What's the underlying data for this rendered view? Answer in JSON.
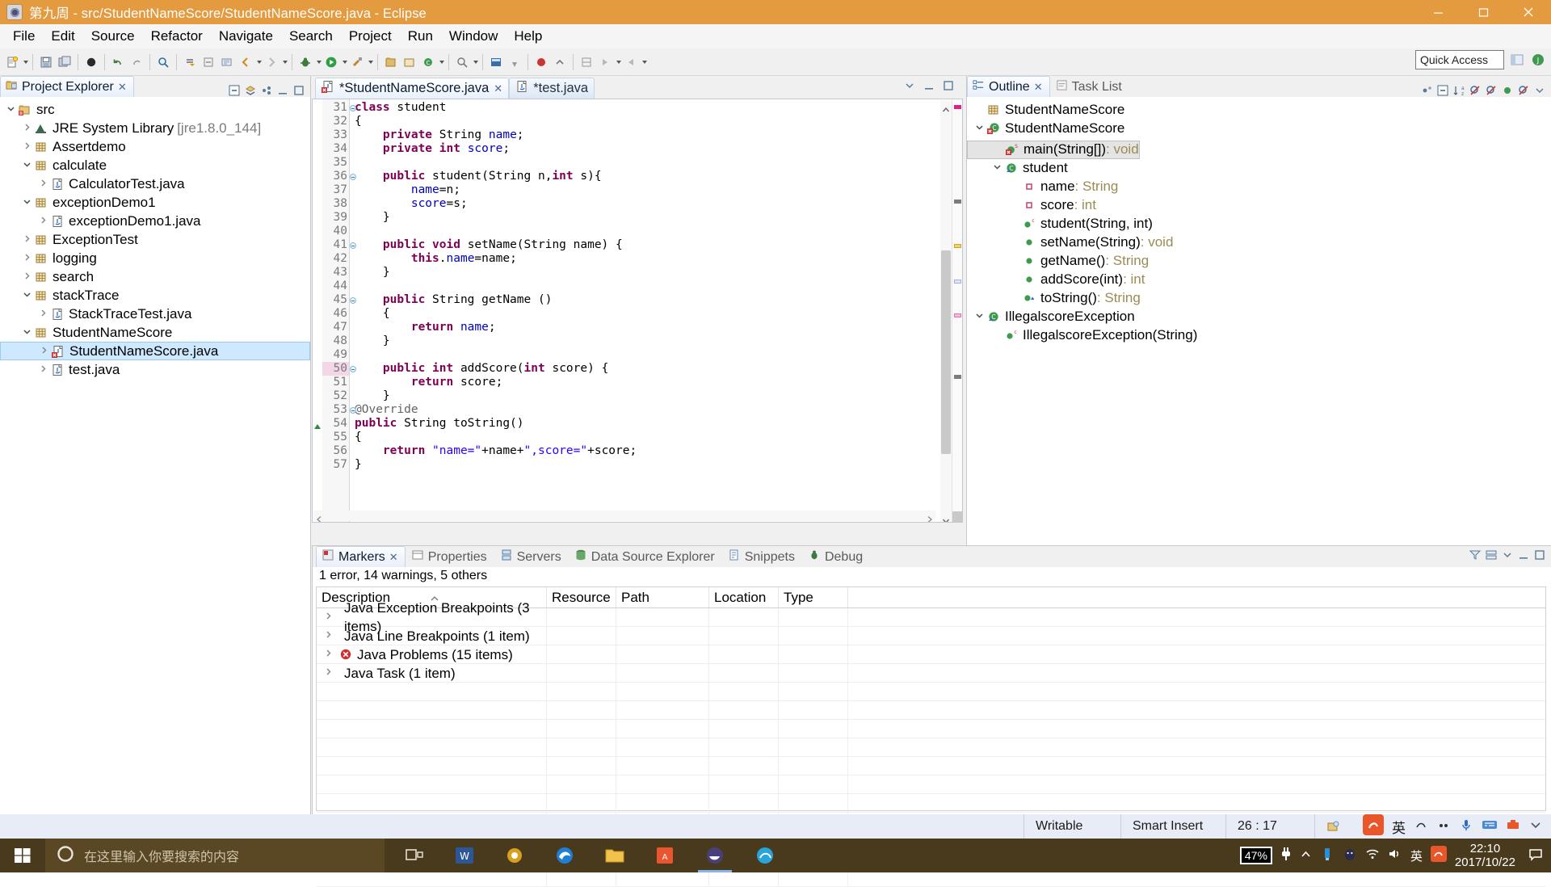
{
  "window": {
    "title": "第九周 - src/StudentNameScore/StudentNameScore.java - Eclipse",
    "minimize_label": "Minimize",
    "maximize_label": "Maximize",
    "close_label": "Close"
  },
  "menubar": {
    "items": [
      "File",
      "Edit",
      "Source",
      "Refactor",
      "Navigate",
      "Search",
      "Project",
      "Run",
      "Window",
      "Help"
    ]
  },
  "toolbar": {
    "quick_access_placeholder": "Quick Access"
  },
  "explorer": {
    "tab_label": "Project Explorer",
    "tree": [
      {
        "depth": 0,
        "twist": "v",
        "icon": "source-folder-icon",
        "label": "src",
        "dim": "",
        "selected": false
      },
      {
        "depth": 1,
        "twist": ">",
        "icon": "library-icon",
        "label": "JRE System Library",
        "dim": "[jre1.8.0_144]",
        "selected": false
      },
      {
        "depth": 1,
        "twist": ">",
        "icon": "package-icon",
        "label": "Assertdemo",
        "dim": "",
        "selected": false
      },
      {
        "depth": 1,
        "twist": "v",
        "icon": "package-icon",
        "label": "calculate",
        "dim": "",
        "selected": false
      },
      {
        "depth": 2,
        "twist": ">",
        "icon": "java-file-icon",
        "label": "CalculatorTest.java",
        "dim": "",
        "selected": false
      },
      {
        "depth": 1,
        "twist": "v",
        "icon": "package-icon",
        "label": "exceptionDemo1",
        "dim": "",
        "selected": false
      },
      {
        "depth": 2,
        "twist": ">",
        "icon": "java-file-icon",
        "label": "exceptionDemo1.java",
        "dim": "",
        "selected": false
      },
      {
        "depth": 1,
        "twist": ">",
        "icon": "package-icon",
        "label": "ExceptionTest",
        "dim": "",
        "selected": false
      },
      {
        "depth": 1,
        "twist": ">",
        "icon": "package-icon",
        "label": "logging",
        "dim": "",
        "selected": false
      },
      {
        "depth": 1,
        "twist": ">",
        "icon": "package-icon",
        "label": "search",
        "dim": "",
        "selected": false
      },
      {
        "depth": 1,
        "twist": "v",
        "icon": "package-icon",
        "label": "stackTrace",
        "dim": "",
        "selected": false
      },
      {
        "depth": 2,
        "twist": ">",
        "icon": "java-file-icon",
        "label": "StackTraceTest.java",
        "dim": "",
        "selected": false
      },
      {
        "depth": 1,
        "twist": "v",
        "icon": "package-icon",
        "label": "StudentNameScore",
        "dim": "",
        "selected": false
      },
      {
        "depth": 2,
        "twist": ">",
        "icon": "java-file-error-icon",
        "label": "StudentNameScore.java",
        "dim": "",
        "selected": true
      },
      {
        "depth": 2,
        "twist": ">",
        "icon": "java-file-icon",
        "label": "test.java",
        "dim": "",
        "selected": false
      }
    ]
  },
  "editor": {
    "tabs": [
      {
        "label": "*StudentNameScore.java",
        "active": true,
        "icon": "java-file-error-icon",
        "closable": true
      },
      {
        "label": "*test.java",
        "active": false,
        "icon": "java-file-icon",
        "closable": false
      }
    ],
    "first_line": 31,
    "current_line": 50,
    "lines": [
      {
        "n": 31,
        "fold": true,
        "marker": "",
        "tokens": [
          {
            "t": "class ",
            "c": "kw"
          },
          {
            "t": "student",
            "c": ""
          }
        ]
      },
      {
        "n": 32,
        "fold": false,
        "marker": "",
        "tokens": [
          {
            "t": "{",
            "c": ""
          }
        ]
      },
      {
        "n": 33,
        "fold": false,
        "marker": "",
        "tokens": [
          {
            "t": "    ",
            "c": ""
          },
          {
            "t": "private ",
            "c": "kw"
          },
          {
            "t": "String ",
            "c": ""
          },
          {
            "t": "name",
            "c": "fld"
          },
          {
            "t": ";",
            "c": ""
          }
        ]
      },
      {
        "n": 34,
        "fold": false,
        "marker": "",
        "tokens": [
          {
            "t": "    ",
            "c": ""
          },
          {
            "t": "private int ",
            "c": "kw"
          },
          {
            "t": "score",
            "c": "fld"
          },
          {
            "t": ";",
            "c": ""
          }
        ]
      },
      {
        "n": 35,
        "fold": false,
        "marker": "",
        "tokens": [
          {
            "t": "",
            "c": ""
          }
        ]
      },
      {
        "n": 36,
        "fold": true,
        "marker": "",
        "tokens": [
          {
            "t": "    ",
            "c": ""
          },
          {
            "t": "public ",
            "c": "kw"
          },
          {
            "t": "student(String n,",
            "c": ""
          },
          {
            "t": "int",
            "c": "kw"
          },
          {
            "t": " s){",
            "c": ""
          }
        ]
      },
      {
        "n": 37,
        "fold": false,
        "marker": "",
        "tokens": [
          {
            "t": "        ",
            "c": ""
          },
          {
            "t": "name",
            "c": "fld"
          },
          {
            "t": "=n;",
            "c": ""
          }
        ]
      },
      {
        "n": 38,
        "fold": false,
        "marker": "",
        "tokens": [
          {
            "t": "        ",
            "c": ""
          },
          {
            "t": "score",
            "c": "fld"
          },
          {
            "t": "=s;",
            "c": ""
          }
        ]
      },
      {
        "n": 39,
        "fold": false,
        "marker": "",
        "tokens": [
          {
            "t": "    }",
            "c": ""
          }
        ]
      },
      {
        "n": 40,
        "fold": false,
        "marker": "",
        "tokens": [
          {
            "t": "",
            "c": ""
          }
        ]
      },
      {
        "n": 41,
        "fold": true,
        "marker": "",
        "tokens": [
          {
            "t": "    ",
            "c": ""
          },
          {
            "t": "public void ",
            "c": "kw"
          },
          {
            "t": "setName(String name) {",
            "c": ""
          }
        ]
      },
      {
        "n": 42,
        "fold": false,
        "marker": "",
        "tokens": [
          {
            "t": "        ",
            "c": ""
          },
          {
            "t": "this",
            "c": "kw"
          },
          {
            "t": ".",
            "c": ""
          },
          {
            "t": "name",
            "c": "fld"
          },
          {
            "t": "=name;",
            "c": ""
          }
        ]
      },
      {
        "n": 43,
        "fold": false,
        "marker": "",
        "tokens": [
          {
            "t": "    }",
            "c": ""
          }
        ]
      },
      {
        "n": 44,
        "fold": false,
        "marker": "",
        "tokens": [
          {
            "t": "",
            "c": ""
          }
        ]
      },
      {
        "n": 45,
        "fold": true,
        "marker": "",
        "tokens": [
          {
            "t": "    ",
            "c": ""
          },
          {
            "t": "public ",
            "c": "kw"
          },
          {
            "t": "String getName ()",
            "c": ""
          }
        ]
      },
      {
        "n": 46,
        "fold": false,
        "marker": "",
        "tokens": [
          {
            "t": "    {",
            "c": ""
          }
        ]
      },
      {
        "n": 47,
        "fold": false,
        "marker": "",
        "tokens": [
          {
            "t": "        ",
            "c": ""
          },
          {
            "t": "return ",
            "c": "kw"
          },
          {
            "t": "name",
            "c": "fld"
          },
          {
            "t": ";",
            "c": ""
          }
        ]
      },
      {
        "n": 48,
        "fold": false,
        "marker": "",
        "tokens": [
          {
            "t": "    }",
            "c": ""
          }
        ]
      },
      {
        "n": 49,
        "fold": false,
        "marker": "",
        "tokens": [
          {
            "t": "",
            "c": ""
          }
        ]
      },
      {
        "n": 50,
        "fold": true,
        "marker": "",
        "tokens": [
          {
            "t": "    ",
            "c": ""
          },
          {
            "t": "public int ",
            "c": "kw"
          },
          {
            "t": "addScore(",
            "c": ""
          },
          {
            "t": "int",
            "c": "kw"
          },
          {
            "t": " score) {",
            "c": ""
          }
        ]
      },
      {
        "n": 51,
        "fold": false,
        "marker": "",
        "tokens": [
          {
            "t": "        ",
            "c": ""
          },
          {
            "t": "return ",
            "c": "kw"
          },
          {
            "t": "score;",
            "c": ""
          }
        ]
      },
      {
        "n": 52,
        "fold": false,
        "marker": "",
        "tokens": [
          {
            "t": "    }",
            "c": ""
          }
        ]
      },
      {
        "n": 53,
        "fold": true,
        "marker": "",
        "tokens": [
          {
            "t": "@Override",
            "c": "ann"
          }
        ]
      },
      {
        "n": 54,
        "fold": false,
        "marker": "override",
        "tokens": [
          {
            "t": "public ",
            "c": "kw"
          },
          {
            "t": "String toString()",
            "c": ""
          }
        ]
      },
      {
        "n": 55,
        "fold": false,
        "marker": "",
        "tokens": [
          {
            "t": "{",
            "c": ""
          }
        ]
      },
      {
        "n": 56,
        "fold": false,
        "marker": "",
        "tokens": [
          {
            "t": "    ",
            "c": ""
          },
          {
            "t": "return ",
            "c": "kw"
          },
          {
            "t": "\"name=\"",
            "c": "str"
          },
          {
            "t": "+name+",
            "c": ""
          },
          {
            "t": "\",score=\"",
            "c": "str"
          },
          {
            "t": "+score;",
            "c": ""
          }
        ]
      },
      {
        "n": 57,
        "fold": false,
        "marker": "",
        "tokens": [
          {
            "t": "}",
            "c": ""
          }
        ]
      }
    ]
  },
  "outline": {
    "tabs": [
      {
        "label": "Outline",
        "active": true,
        "icon": "outline-icon"
      },
      {
        "label": "Task List",
        "active": false,
        "icon": "tasklist-icon"
      }
    ],
    "items": [
      {
        "depth": 0,
        "twist": "",
        "icon": "package-icon",
        "label": "StudentNameScore",
        "type": "",
        "selected": false
      },
      {
        "depth": 0,
        "twist": "v",
        "icon": "class-error-icon",
        "label": "StudentNameScore",
        "type": "",
        "selected": false
      },
      {
        "depth": 1,
        "twist": "",
        "icon": "method-static-error-icon",
        "label": "main(String[])",
        "type": " : void",
        "selected": true
      },
      {
        "depth": 1,
        "twist": "v",
        "icon": "class-icon",
        "label": "student",
        "type": "",
        "selected": false
      },
      {
        "depth": 2,
        "twist": "",
        "icon": "field-private-icon",
        "label": "name",
        "type": " : String",
        "selected": false
      },
      {
        "depth": 2,
        "twist": "",
        "icon": "field-private-icon",
        "label": "score",
        "type": " : int",
        "selected": false
      },
      {
        "depth": 2,
        "twist": "",
        "icon": "constructor-icon",
        "label": "student(String, int)",
        "type": "",
        "selected": false
      },
      {
        "depth": 2,
        "twist": "",
        "icon": "method-icon",
        "label": "setName(String)",
        "type": " : void",
        "selected": false
      },
      {
        "depth": 2,
        "twist": "",
        "icon": "method-icon",
        "label": "getName()",
        "type": " : String",
        "selected": false
      },
      {
        "depth": 2,
        "twist": "",
        "icon": "method-icon",
        "label": "addScore(int)",
        "type": " : int",
        "selected": false
      },
      {
        "depth": 2,
        "twist": "",
        "icon": "method-override-icon",
        "label": "toString()",
        "type": " : String",
        "selected": false
      },
      {
        "depth": 0,
        "twist": "v",
        "icon": "class-icon",
        "label": "IllegalscoreException",
        "type": "",
        "selected": false
      },
      {
        "depth": 1,
        "twist": "",
        "icon": "constructor-icon",
        "label": "IllegalscoreException(String)",
        "type": "",
        "selected": false
      }
    ]
  },
  "markers": {
    "tabs": [
      {
        "label": "Markers",
        "active": true,
        "icon": "markers-icon"
      },
      {
        "label": "Properties",
        "active": false,
        "icon": "properties-icon"
      },
      {
        "label": "Servers",
        "active": false,
        "icon": "servers-icon"
      },
      {
        "label": "Data Source Explorer",
        "active": false,
        "icon": "datasource-icon"
      },
      {
        "label": "Snippets",
        "active": false,
        "icon": "snippets-icon"
      },
      {
        "label": "Debug",
        "active": false,
        "icon": "debug-icon"
      }
    ],
    "summary": "1 error, 14 warnings, 5 others",
    "columns": [
      "Description",
      "Resource",
      "Path",
      "Location",
      "Type"
    ],
    "rows": [
      {
        "icon": "",
        "description": "Java Exception Breakpoints (3 items)",
        "resource": "",
        "path": "",
        "location": "",
        "type": ""
      },
      {
        "icon": "",
        "description": "Java Line Breakpoints (1 item)",
        "resource": "",
        "path": "",
        "location": "",
        "type": ""
      },
      {
        "icon": "error-icon",
        "description": "Java Problems (15 items)",
        "resource": "",
        "path": "",
        "location": "",
        "type": ""
      },
      {
        "icon": "",
        "description": "Java Task (1 item)",
        "resource": "",
        "path": "",
        "location": "",
        "type": ""
      }
    ]
  },
  "statusbar": {
    "writable": "Writable",
    "insert_mode": "Smart Insert",
    "cursor_position": "26 : 17"
  },
  "taskbar": {
    "search_placeholder": "在这里输入你要搜索的内容",
    "battery": "47%",
    "ime_lang": "英",
    "clock_time": "22:10",
    "clock_date": "2017/10/22"
  },
  "colors": {
    "title_bar": "#e49a3e",
    "accent_blue": "#3c7ca8",
    "selection": "#cde8ff",
    "keyword": "#7f0055",
    "string": "#2a00ff",
    "field": "#0000c0",
    "taskbar": "#4a3a1d",
    "battery_green": "#19a24a"
  }
}
